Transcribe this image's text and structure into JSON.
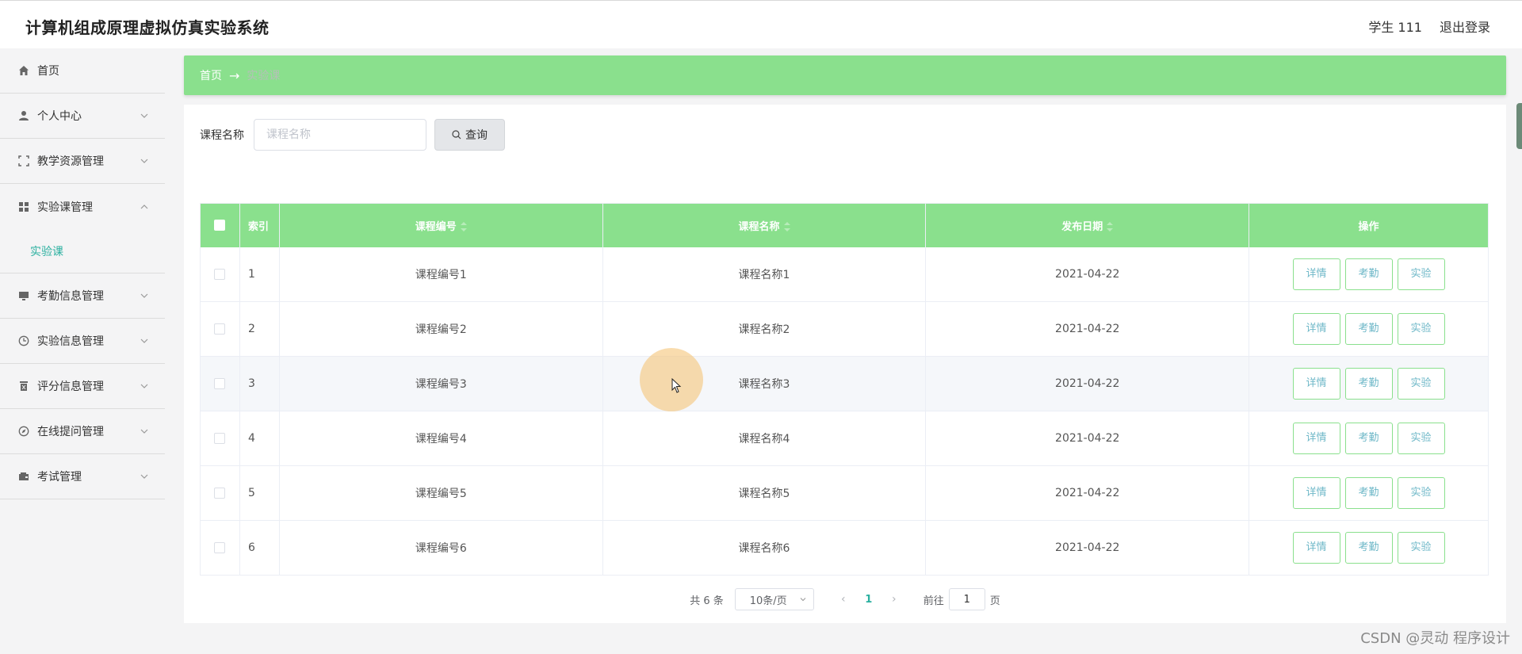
{
  "app": {
    "title": "计算机组成原理虚拟仿真实验系统"
  },
  "header": {
    "user": "学生 111",
    "logout": "退出登录"
  },
  "sidebar": {
    "items": [
      {
        "label": "首页",
        "icon": "home-icon"
      },
      {
        "label": "个人中心",
        "icon": "user-icon"
      },
      {
        "label": "教学资源管理",
        "icon": "fullscreen-icon"
      },
      {
        "label": "实验课管理",
        "icon": "grid-icon",
        "expanded": true
      },
      {
        "label": "考勤信息管理",
        "icon": "monitor-icon"
      },
      {
        "label": "实验信息管理",
        "icon": "clock-icon"
      },
      {
        "label": "评分信息管理",
        "icon": "trash-icon"
      },
      {
        "label": "在线提问管理",
        "icon": "compass-icon"
      },
      {
        "label": "考试管理",
        "icon": "wallet-icon"
      }
    ],
    "submenu": {
      "label": "实验课"
    }
  },
  "breadcrumb": {
    "home": "首页",
    "separator": "→",
    "current": "实验课"
  },
  "search": {
    "label": "课程名称",
    "placeholder": "课程名称",
    "value": "",
    "button": "查询"
  },
  "table": {
    "headers": {
      "index": "索引",
      "code": "课程编号",
      "name": "课程名称",
      "date": "发布日期",
      "actions": "操作"
    },
    "rows": [
      {
        "index": "1",
        "code": "课程编号1",
        "name": "课程名称1",
        "date": "2021-04-22"
      },
      {
        "index": "2",
        "code": "课程编号2",
        "name": "课程名称2",
        "date": "2021-04-22"
      },
      {
        "index": "3",
        "code": "课程编号3",
        "name": "课程名称3",
        "date": "2021-04-22"
      },
      {
        "index": "4",
        "code": "课程编号4",
        "name": "课程名称4",
        "date": "2021-04-22"
      },
      {
        "index": "5",
        "code": "课程编号5",
        "name": "课程名称5",
        "date": "2021-04-22"
      },
      {
        "index": "6",
        "code": "课程编号6",
        "name": "课程名称6",
        "date": "2021-04-22"
      }
    ],
    "actions": {
      "detail": "详情",
      "attendance": "考勤",
      "experiment": "实验"
    }
  },
  "pagination": {
    "total": "共 6 条",
    "page_size": "10条/页",
    "prev": "‹",
    "current_page": "1",
    "next": "›",
    "goto_prefix": "前往",
    "goto_value": "1",
    "goto_suffix": "页"
  },
  "watermark": "CSDN @灵动 程序设计",
  "colors": {
    "accent_green": "#8ae08d",
    "link_teal": "#2bb0a0",
    "button_text": "#6fb8c8"
  }
}
